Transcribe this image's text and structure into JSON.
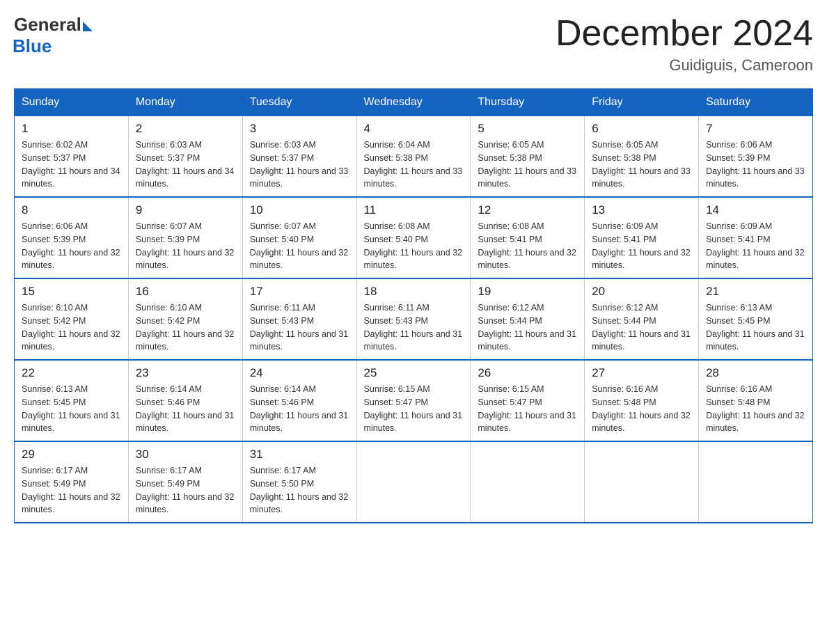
{
  "logo": {
    "general": "General",
    "blue": "Blue"
  },
  "title": "December 2024",
  "location": "Guidiguis, Cameroon",
  "days_of_week": [
    "Sunday",
    "Monday",
    "Tuesday",
    "Wednesday",
    "Thursday",
    "Friday",
    "Saturday"
  ],
  "weeks": [
    [
      {
        "day": "1",
        "sunrise": "6:02 AM",
        "sunset": "5:37 PM",
        "daylight": "11 hours and 34 minutes."
      },
      {
        "day": "2",
        "sunrise": "6:03 AM",
        "sunset": "5:37 PM",
        "daylight": "11 hours and 34 minutes."
      },
      {
        "day": "3",
        "sunrise": "6:03 AM",
        "sunset": "5:37 PM",
        "daylight": "11 hours and 33 minutes."
      },
      {
        "day": "4",
        "sunrise": "6:04 AM",
        "sunset": "5:38 PM",
        "daylight": "11 hours and 33 minutes."
      },
      {
        "day": "5",
        "sunrise": "6:05 AM",
        "sunset": "5:38 PM",
        "daylight": "11 hours and 33 minutes."
      },
      {
        "day": "6",
        "sunrise": "6:05 AM",
        "sunset": "5:38 PM",
        "daylight": "11 hours and 33 minutes."
      },
      {
        "day": "7",
        "sunrise": "6:06 AM",
        "sunset": "5:39 PM",
        "daylight": "11 hours and 33 minutes."
      }
    ],
    [
      {
        "day": "8",
        "sunrise": "6:06 AM",
        "sunset": "5:39 PM",
        "daylight": "11 hours and 32 minutes."
      },
      {
        "day": "9",
        "sunrise": "6:07 AM",
        "sunset": "5:39 PM",
        "daylight": "11 hours and 32 minutes."
      },
      {
        "day": "10",
        "sunrise": "6:07 AM",
        "sunset": "5:40 PM",
        "daylight": "11 hours and 32 minutes."
      },
      {
        "day": "11",
        "sunrise": "6:08 AM",
        "sunset": "5:40 PM",
        "daylight": "11 hours and 32 minutes."
      },
      {
        "day": "12",
        "sunrise": "6:08 AM",
        "sunset": "5:41 PM",
        "daylight": "11 hours and 32 minutes."
      },
      {
        "day": "13",
        "sunrise": "6:09 AM",
        "sunset": "5:41 PM",
        "daylight": "11 hours and 32 minutes."
      },
      {
        "day": "14",
        "sunrise": "6:09 AM",
        "sunset": "5:41 PM",
        "daylight": "11 hours and 32 minutes."
      }
    ],
    [
      {
        "day": "15",
        "sunrise": "6:10 AM",
        "sunset": "5:42 PM",
        "daylight": "11 hours and 32 minutes."
      },
      {
        "day": "16",
        "sunrise": "6:10 AM",
        "sunset": "5:42 PM",
        "daylight": "11 hours and 32 minutes."
      },
      {
        "day": "17",
        "sunrise": "6:11 AM",
        "sunset": "5:43 PM",
        "daylight": "11 hours and 31 minutes."
      },
      {
        "day": "18",
        "sunrise": "6:11 AM",
        "sunset": "5:43 PM",
        "daylight": "11 hours and 31 minutes."
      },
      {
        "day": "19",
        "sunrise": "6:12 AM",
        "sunset": "5:44 PM",
        "daylight": "11 hours and 31 minutes."
      },
      {
        "day": "20",
        "sunrise": "6:12 AM",
        "sunset": "5:44 PM",
        "daylight": "11 hours and 31 minutes."
      },
      {
        "day": "21",
        "sunrise": "6:13 AM",
        "sunset": "5:45 PM",
        "daylight": "11 hours and 31 minutes."
      }
    ],
    [
      {
        "day": "22",
        "sunrise": "6:13 AM",
        "sunset": "5:45 PM",
        "daylight": "11 hours and 31 minutes."
      },
      {
        "day": "23",
        "sunrise": "6:14 AM",
        "sunset": "5:46 PM",
        "daylight": "11 hours and 31 minutes."
      },
      {
        "day": "24",
        "sunrise": "6:14 AM",
        "sunset": "5:46 PM",
        "daylight": "11 hours and 31 minutes."
      },
      {
        "day": "25",
        "sunrise": "6:15 AM",
        "sunset": "5:47 PM",
        "daylight": "11 hours and 31 minutes."
      },
      {
        "day": "26",
        "sunrise": "6:15 AM",
        "sunset": "5:47 PM",
        "daylight": "11 hours and 31 minutes."
      },
      {
        "day": "27",
        "sunrise": "6:16 AM",
        "sunset": "5:48 PM",
        "daylight": "11 hours and 32 minutes."
      },
      {
        "day": "28",
        "sunrise": "6:16 AM",
        "sunset": "5:48 PM",
        "daylight": "11 hours and 32 minutes."
      }
    ],
    [
      {
        "day": "29",
        "sunrise": "6:17 AM",
        "sunset": "5:49 PM",
        "daylight": "11 hours and 32 minutes."
      },
      {
        "day": "30",
        "sunrise": "6:17 AM",
        "sunset": "5:49 PM",
        "daylight": "11 hours and 32 minutes."
      },
      {
        "day": "31",
        "sunrise": "6:17 AM",
        "sunset": "5:50 PM",
        "daylight": "11 hours and 32 minutes."
      },
      null,
      null,
      null,
      null
    ]
  ]
}
